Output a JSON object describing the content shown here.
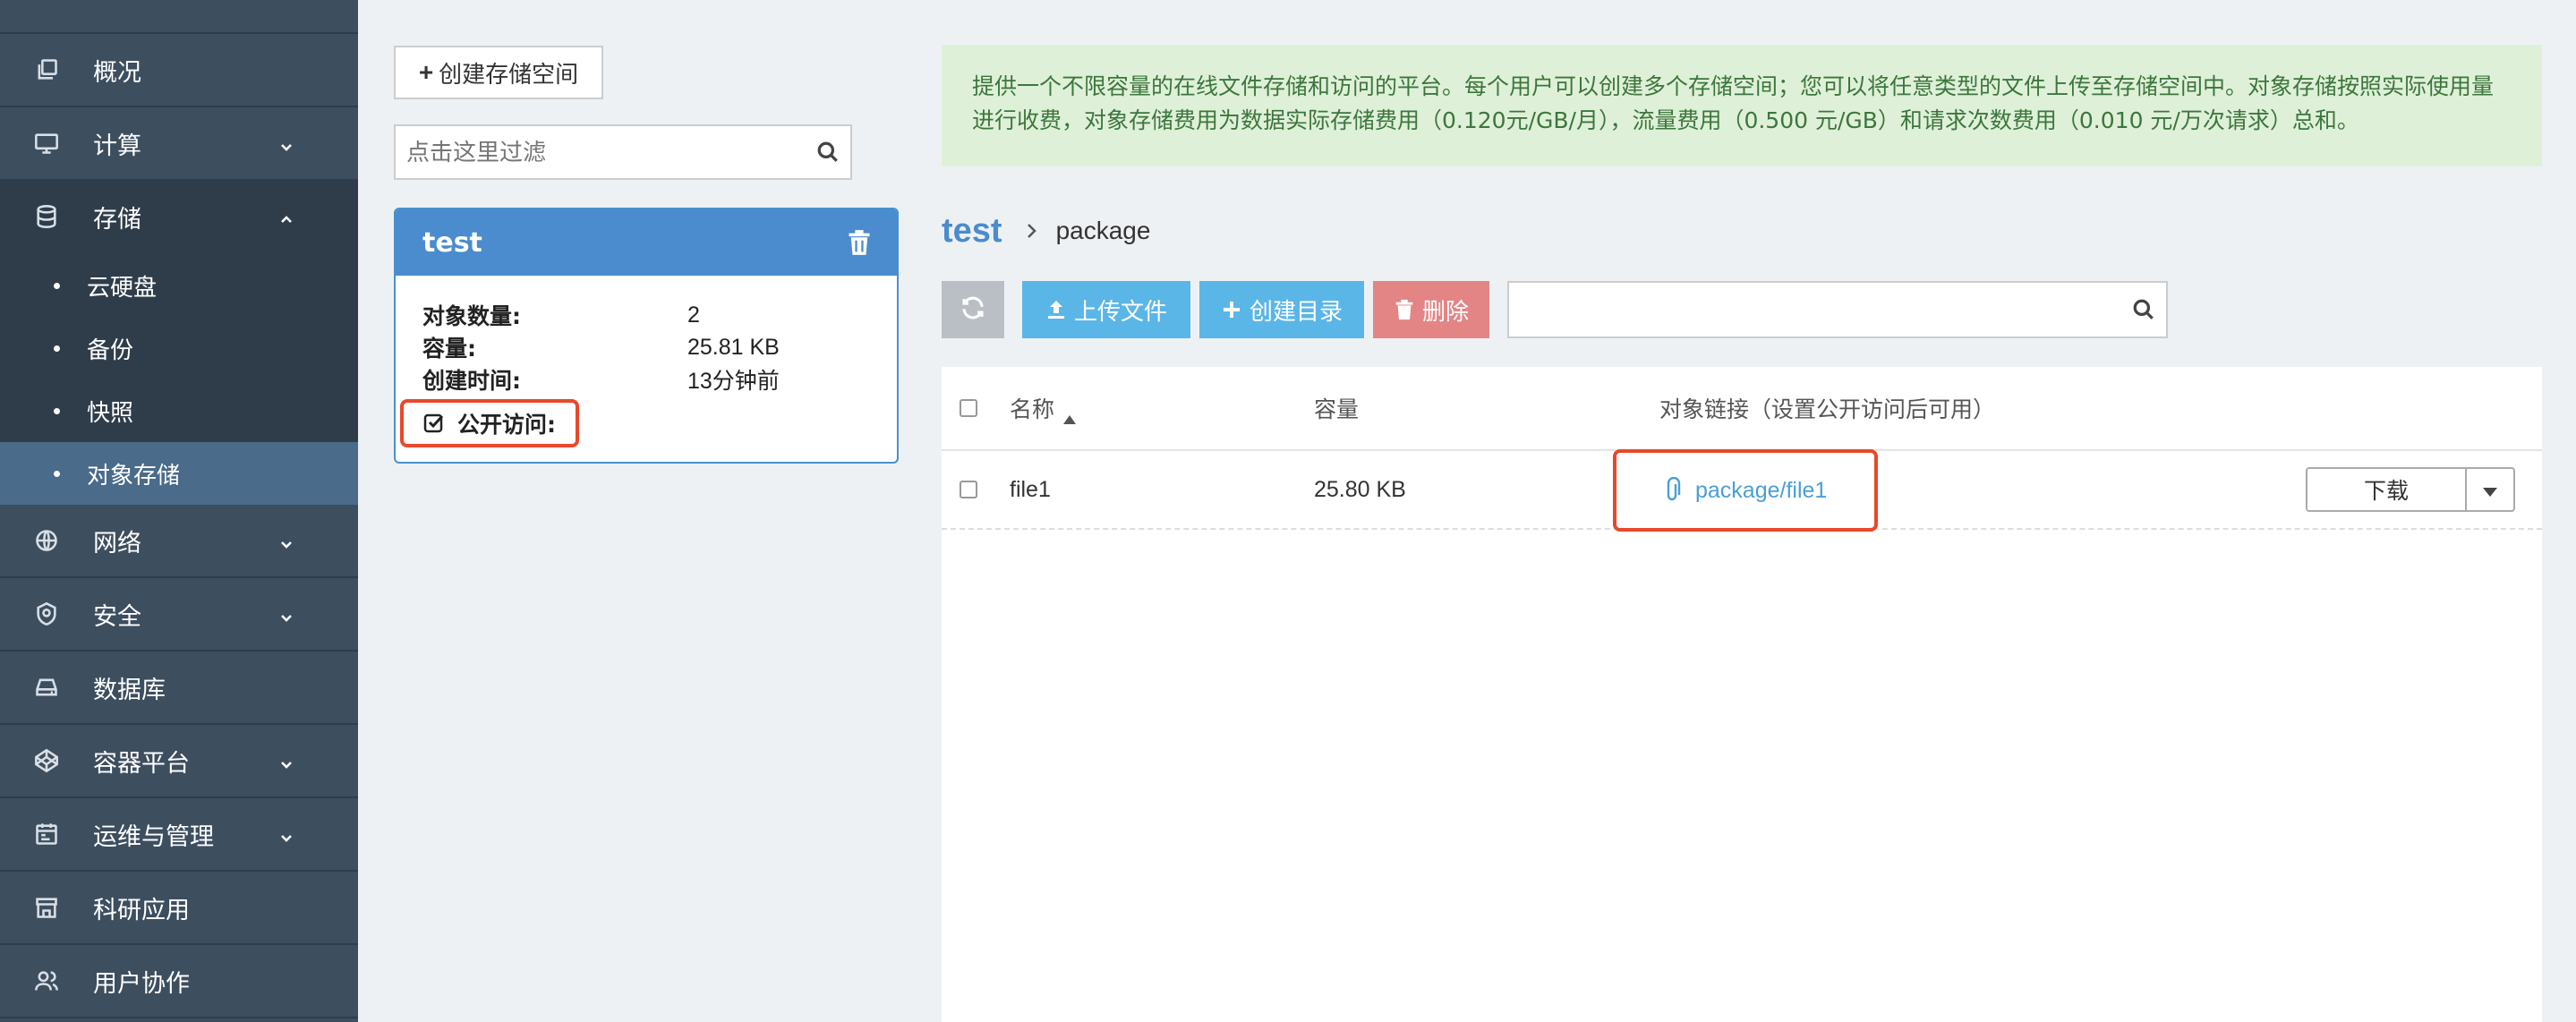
{
  "sidebar": {
    "items": [
      {
        "label": "概况",
        "icon": "copy-icon"
      },
      {
        "label": "计算",
        "icon": "monitor-icon"
      },
      {
        "label": "存储",
        "icon": "database-icon"
      },
      {
        "label": "网络",
        "icon": "network-icon"
      },
      {
        "label": "安全",
        "icon": "shield-icon"
      },
      {
        "label": "数据库",
        "icon": "hdd-icon"
      },
      {
        "label": "容器平台",
        "icon": "codepen-icon"
      },
      {
        "label": "运维与管理",
        "icon": "calendar-icon"
      },
      {
        "label": "科研应用",
        "icon": "store-icon"
      },
      {
        "label": "用户协作",
        "icon": "users-icon"
      }
    ],
    "storage_sub": [
      {
        "label": "云硬盘"
      },
      {
        "label": "备份"
      },
      {
        "label": "快照"
      },
      {
        "label": "对象存储"
      }
    ],
    "active_color": "#4a6b8a"
  },
  "bucket_panel": {
    "create_label": "创建存储空间",
    "filter_placeholder": "点击这里过滤",
    "bucket": {
      "name": "test",
      "object_count_label": "对象数量:",
      "object_count": "2",
      "size_label": "容量:",
      "size": "25.81 KB",
      "created_label": "创建时间:",
      "created": "13分钟前",
      "public_label": "公开访问:",
      "public_checked": true
    }
  },
  "notice": {
    "text": "提供一个不限容量的在线文件存储和访问的平台。每个用户可以创建多个存储空间；您可以将任意类型的文件上传至存储空间中。对象存储按照实际使用量进行收费，对象存储费用为数据实际存储费用（0.120元/GB/月），流量费用（0.500 元/GB）和请求次数费用（0.010 元/万次请求）总和。"
  },
  "breadcrumb": {
    "root": "test",
    "current": "package"
  },
  "toolbar": {
    "upload_label": "上传文件",
    "mkdir_label": "创建目录",
    "delete_label": "删除",
    "search_value": ""
  },
  "table": {
    "headers": {
      "name": "名称",
      "size": "容量",
      "link": "对象链接（设置公开访问后可用）"
    },
    "rows": [
      {
        "name": "file1",
        "size": "25.80 KB",
        "link": "package/file1",
        "action": "下载"
      }
    ]
  }
}
